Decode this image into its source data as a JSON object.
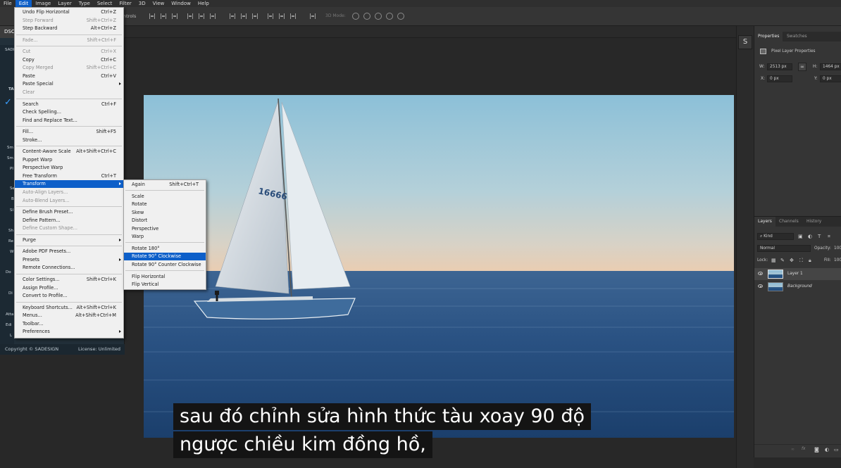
{
  "menubar": {
    "items": [
      "File",
      "Edit",
      "Image",
      "Layer",
      "Type",
      "Select",
      "Filter",
      "3D",
      "View",
      "Window",
      "Help"
    ],
    "active": "Edit"
  },
  "options_bar": {
    "controls_label": "ntrols",
    "mode_label": "3D Mode:"
  },
  "document": {
    "tab_label": "DSC"
  },
  "edit_menu": {
    "groups": [
      [
        {
          "label": "Undo Flip Horizontal",
          "shortcut": "Ctrl+Z",
          "disabled": false
        },
        {
          "label": "Step Forward",
          "shortcut": "Shift+Ctrl+Z",
          "disabled": true
        },
        {
          "label": "Step Backward",
          "shortcut": "Alt+Ctrl+Z",
          "disabled": false
        }
      ],
      [
        {
          "label": "Fade...",
          "shortcut": "Shift+Ctrl+F",
          "disabled": true
        }
      ],
      [
        {
          "label": "Cut",
          "shortcut": "Ctrl+X",
          "disabled": true
        },
        {
          "label": "Copy",
          "shortcut": "Ctrl+C",
          "disabled": false
        },
        {
          "label": "Copy Merged",
          "shortcut": "Shift+Ctrl+C",
          "disabled": true
        },
        {
          "label": "Paste",
          "shortcut": "Ctrl+V",
          "disabled": false
        },
        {
          "label": "Paste Special",
          "shortcut": "",
          "disabled": false,
          "submenu": true
        },
        {
          "label": "Clear",
          "shortcut": "",
          "disabled": true
        }
      ],
      [
        {
          "label": "Search",
          "shortcut": "Ctrl+F",
          "disabled": false
        },
        {
          "label": "Check Spelling...",
          "shortcut": "",
          "disabled": false
        },
        {
          "label": "Find and Replace Text...",
          "shortcut": "",
          "disabled": false
        }
      ],
      [
        {
          "label": "Fill...",
          "shortcut": "Shift+F5",
          "disabled": false
        },
        {
          "label": "Stroke...",
          "shortcut": "",
          "disabled": false
        }
      ],
      [
        {
          "label": "Content-Aware Scale",
          "shortcut": "Alt+Shift+Ctrl+C",
          "disabled": false
        },
        {
          "label": "Puppet Warp",
          "shortcut": "",
          "disabled": false
        },
        {
          "label": "Perspective Warp",
          "shortcut": "",
          "disabled": false
        },
        {
          "label": "Free Transform",
          "shortcut": "Ctrl+T",
          "disabled": false
        },
        {
          "label": "Transform",
          "shortcut": "",
          "disabled": false,
          "submenu": true,
          "highlighted": true
        },
        {
          "label": "Auto-Align Layers...",
          "shortcut": "",
          "disabled": true
        },
        {
          "label": "Auto-Blend Layers...",
          "shortcut": "",
          "disabled": true
        }
      ],
      [
        {
          "label": "Define Brush Preset...",
          "shortcut": "",
          "disabled": false
        },
        {
          "label": "Define Pattern...",
          "shortcut": "",
          "disabled": false
        },
        {
          "label": "Define Custom Shape...",
          "shortcut": "",
          "disabled": true
        }
      ],
      [
        {
          "label": "Purge",
          "shortcut": "",
          "disabled": false,
          "submenu": true
        }
      ],
      [
        {
          "label": "Adobe PDF Presets...",
          "shortcut": "",
          "disabled": false
        },
        {
          "label": "Presets",
          "shortcut": "",
          "disabled": false,
          "submenu": true
        },
        {
          "label": "Remote Connections...",
          "shortcut": "",
          "disabled": false
        }
      ],
      [
        {
          "label": "Color Settings...",
          "shortcut": "Shift+Ctrl+K",
          "disabled": false
        },
        {
          "label": "Assign Profile...",
          "shortcut": "",
          "disabled": false
        },
        {
          "label": "Convert to Profile...",
          "shortcut": "",
          "disabled": false
        }
      ],
      [
        {
          "label": "Keyboard Shortcuts...",
          "shortcut": "Alt+Shift+Ctrl+K",
          "disabled": false
        },
        {
          "label": "Menus...",
          "shortcut": "Alt+Shift+Ctrl+M",
          "disabled": false
        },
        {
          "label": "Toolbar...",
          "shortcut": "",
          "disabled": false
        },
        {
          "label": "Preferences",
          "shortcut": "",
          "disabled": false,
          "submenu": true
        }
      ]
    ]
  },
  "transform_submenu": {
    "groups": [
      [
        {
          "label": "Again",
          "shortcut": "Shift+Ctrl+T"
        }
      ],
      [
        {
          "label": "Scale"
        },
        {
          "label": "Rotate"
        },
        {
          "label": "Skew"
        },
        {
          "label": "Distort"
        },
        {
          "label": "Perspective"
        },
        {
          "label": "Warp"
        }
      ],
      [
        {
          "label": "Rotate 180°"
        },
        {
          "label": "Rotate 90° Clockwise",
          "highlighted": true
        },
        {
          "label": "Rotate 90° Counter Clockwise"
        }
      ],
      [
        {
          "label": "Flip Horizontal"
        },
        {
          "label": "Flip Vertical"
        }
      ]
    ]
  },
  "plugin_panel": {
    "labels": [
      "SADI",
      "TA",
      "Sm",
      "Sm",
      "Pl",
      "Se",
      "B",
      "Sl",
      "Sh",
      "Re",
      "W",
      "Do",
      "Di",
      "Atta",
      "Edi",
      "L"
    ],
    "footer_left": "Copyright © SADESIGN",
    "footer_right": "License: Unlimited"
  },
  "photo": {
    "sail_number": "16666"
  },
  "properties": {
    "tabs": [
      "Properties",
      "Swatches"
    ],
    "title": "Pixel Layer Properties",
    "w_label": "W:",
    "w": "2513 px",
    "h_label": "H:",
    "h": "1464 px",
    "x_label": "X:",
    "x": "0 px",
    "y_label": "Y:",
    "y": "0 px"
  },
  "layers_panel": {
    "tabs": [
      "Layers",
      "Channels",
      "History"
    ],
    "filter": "Kind",
    "blend_mode": "Normal",
    "opacity_label": "Opacity:",
    "opacity": "100",
    "lock_label": "Lock:",
    "fill_label": "Fill:",
    "fill": "100",
    "layers": [
      {
        "name": "Layer 1",
        "selected": true,
        "italic": false
      },
      {
        "name": "Background",
        "selected": false,
        "italic": true
      }
    ],
    "footer_fx": "fx"
  },
  "subtitles": {
    "line1": "sau đó chỉnh sửa hình thức tàu xoay 90 độ",
    "line2": "ngược chiều kim đồng hồ,"
  }
}
